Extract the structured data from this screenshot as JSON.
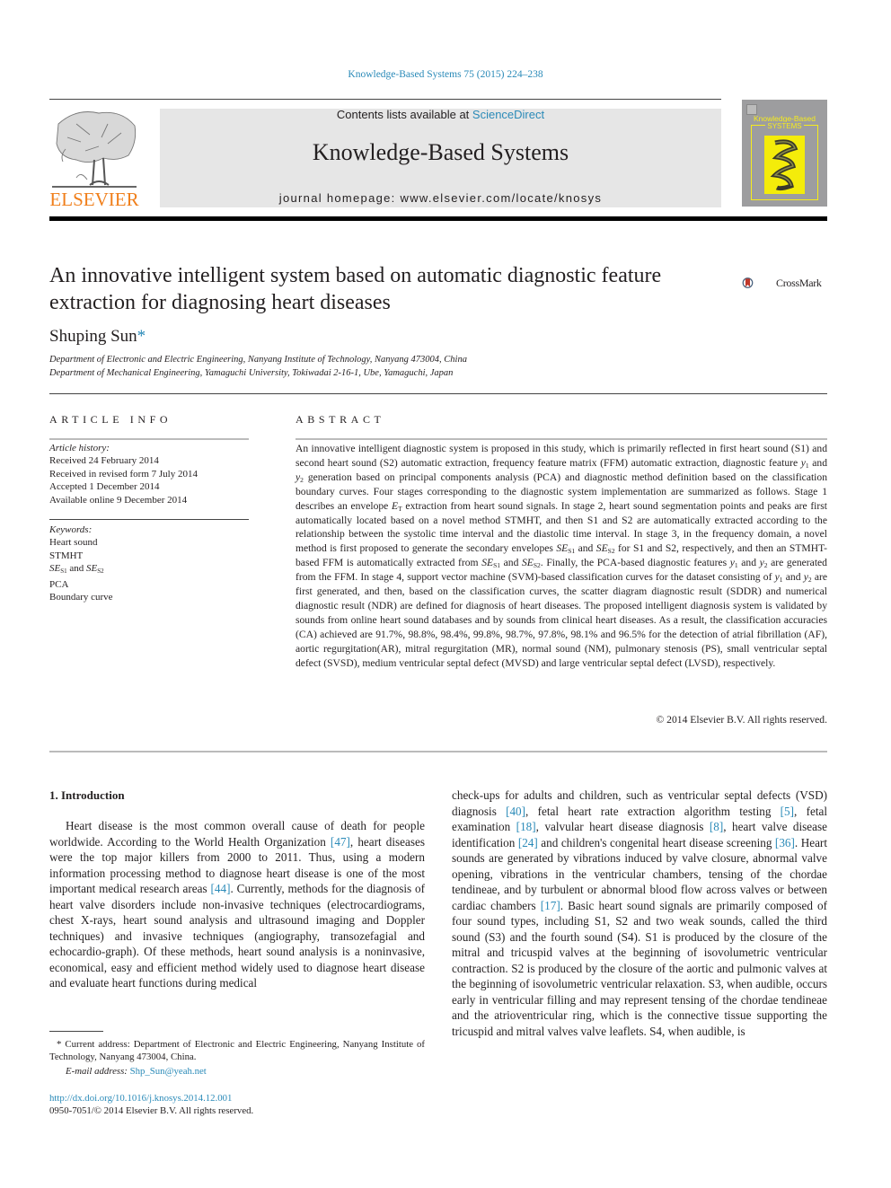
{
  "journal_ref": "Knowledge-Based Systems 75 (2015) 224–238",
  "header": {
    "publisher_logo_text": "ELSEVIER",
    "contents_prefix": "Contents lists available at ",
    "contents_link": "ScienceDirect",
    "journal_title": "Knowledge-Based Systems",
    "homepage_prefix": "journal homepage: ",
    "homepage_url": "www.elsevier.com/locate/knosys",
    "cover_title_line1": "Knowledge-Based",
    "cover_title_line2": "SYSTEMS",
    "colors": {
      "elsevier_orange": "#f07f1b",
      "link_blue": "#2a8ab8",
      "cover_grey": "#9d9d9f",
      "cover_yellow": "#f6ec1c",
      "header_box": "#e6e6e6"
    }
  },
  "article": {
    "title_line1": "An innovative intelligent system based on automatic diagnostic feature",
    "title_line2": "extraction for diagnosing heart diseases",
    "crossmark_label": "CrossMark",
    "author": "Shuping Sun",
    "author_mark": "*",
    "affiliations": [
      "Department of Electronic and Electric Engineering, Nanyang Institute of Technology, Nanyang 473004, China",
      "Department of Mechanical Engineering, Yamaguchi University, Tokiwadai 2-16-1, Ube, Yamaguchi, Japan"
    ]
  },
  "article_info": {
    "heading": "ARTICLE INFO",
    "history_label": "Article history:",
    "history": [
      "Received 24 February 2014",
      "Received in revised form 7 July 2014",
      "Accepted 1 December 2014",
      "Available online 9 December 2014"
    ],
    "keywords_label": "Keywords:",
    "keywords": [
      "Heart sound",
      "STMHT",
      "SE_S1 and SE_S2",
      "PCA",
      "Boundary curve"
    ],
    "kw_se_prefix": "SE",
    "kw_s1": "S1",
    "kw_and": " and ",
    "kw_s2": "S2"
  },
  "abstract": {
    "heading": "ABSTRACT",
    "p1": "An innovative intelligent diagnostic system is proposed in this study, which is primarily reflected in first heart sound (S1) and second heart sound (S2) automatic extraction, frequency feature matrix (FFM) automatic extraction, diagnostic feature ",
    "p2": " generation based on principal components analysis (PCA) and diagnostic method definition based on the classification boundary curves. Four stages corresponding to the diagnostic system implementation are summarized as follows. Stage 1 describes an envelope ",
    "p3": " extraction from heart sound signals. In stage 2, heart sound segmentation points and peaks are first automatically located based on a novel method STMHT, and then S1 and S2 are automatically extracted according to the relationship between the systolic time interval and the diastolic time interval. In stage 3, in the frequency domain, a novel method is first proposed to generate the secondary envelopes ",
    "p4": " for S1 and S2, respectively, and then an STMHT-based FFM is automatically extracted from ",
    "p5": ". Finally, the PCA-based diagnostic features ",
    "p6": " are generated from the FFM. In stage 4, support vector machine (SVM)-based classification curves for the dataset consisting of ",
    "p7": " are first generated, and then, based on the classification curves, the scatter diagram diagnostic result (SDDR) and numerical diagnostic result (NDR) are defined for diagnosis of heart diseases. The proposed intelligent diagnosis system is validated by sounds from online heart sound databases and by sounds from clinical heart diseases. As a result, the classification accuracies (CA) achieved are 91.7%, 98.8%, 98.4%, 99.8%, 98.7%, 97.8%, 98.1% and 96.5% for the detection of atrial fibrillation (AF), aortic regurgitation(AR), mitral regurgitation (MR), normal sound (NM), pulmonary stenosis (PS), small ventricular septal defect (SVSD), medium ventricular septal defect (MVSD) and large ventricular septal defect (LVSD), respectively.",
    "y": "y",
    "sub1": "1",
    "sub2": "2",
    "and": " and ",
    "and_word": "and",
    "E": "E",
    "T": "T",
    "SE": "SE",
    "S1": "S1",
    "S2": "S2",
    "copyright": "© 2014 Elsevier B.V. All rights reserved."
  },
  "intro": {
    "heading": "1. Introduction",
    "left": {
      "t1": "Heart disease is the most common overall cause of death for people worldwide. According to the World Health Organization ",
      "c1": "[47]",
      "t2": ", heart diseases were the top major killers from 2000 to 2011. Thus, using a modern information processing method to diagnose heart disease is one of the most important medical research areas ",
      "c2": "[44]",
      "t3": ". Currently, methods for the diagnosis of heart valve disorders include non-invasive techniques (electrocardiograms, chest X-rays, heart sound analysis and ultrasound imaging and Doppler techniques) and invasive techniques (angiography, transozefagial and echocardio-graph). Of these methods, heart sound analysis is a noninvasive, economical, easy and efficient method widely used to diagnose heart disease and evaluate heart functions during medical"
    },
    "right": {
      "t1": "check-ups for adults and children, such as ventricular septal defects (VSD) diagnosis ",
      "c1": "[40]",
      "t2": ", fetal heart rate extraction algorithm testing ",
      "c2": "[5]",
      "t3": ", fetal examination ",
      "c3": "[18]",
      "t4": ", valvular heart disease diagnosis ",
      "c4": "[8]",
      "t5": ", heart valve disease identification ",
      "c5": "[24]",
      "t6": " and children's congenital heart disease screening ",
      "c6": "[36]",
      "t7": ". Heart sounds are generated by vibrations induced by valve closure, abnormal valve opening, vibrations in the ventricular chambers, tensing of the chordae tendineae, and by turbulent or abnormal blood flow across valves or between cardiac chambers ",
      "c7": "[17]",
      "t8": ". Basic heart sound signals are primarily composed of four sound types, including S1, S2 and two weak sounds, called the third sound (S3) and the fourth sound (S4). S1 is produced by the closure of the mitral and tricuspid valves at the beginning of isovolumetric ventricular contraction. S2 is produced by the closure of the aortic and pulmonic valves at the beginning of isovolumetric ventricular relaxation. S3, when audible, occurs early in ventricular filling and may represent tensing of the chordae tendineae and the atrioventricular ring, which is the connective tissue supporting the tricuspid and mitral valves valve leaflets. S4, when audible, is"
    }
  },
  "footnotes": {
    "current_address": "* Current address: Department of Electronic and Electric Engineering, Nanyang Institute of Technology, Nanyang 473004, China.",
    "email_label": "E-mail address: ",
    "email": "Shp_Sun@yeah.net",
    "doi": "http://dx.doi.org/10.1016/j.knosys.2014.12.001",
    "issn": "0950-7051/© 2014 Elsevier B.V. All rights reserved."
  }
}
